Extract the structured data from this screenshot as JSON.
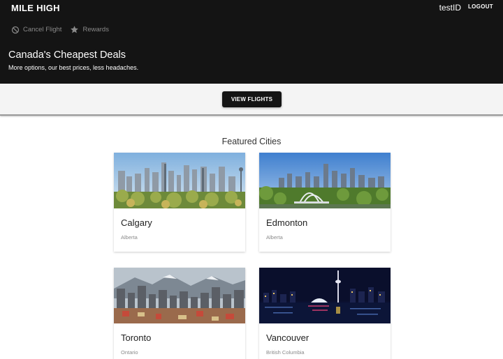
{
  "header": {
    "brand": "MILE HIGH",
    "user": "testID",
    "logout_label": "LOGOUT",
    "nav": [
      {
        "label": "Cancel Flight",
        "icon": "block-icon"
      },
      {
        "label": "Rewards",
        "icon": "star-icon"
      }
    ],
    "title": "Canada's Cheapest Deals",
    "subtitle": "More options, our best prices, less headaches."
  },
  "cta": {
    "label": "VIEW FLIGHTS"
  },
  "featured": {
    "title": "Featured Cities",
    "cities": [
      {
        "name": "Calgary",
        "province": "Alberta"
      },
      {
        "name": "Edmonton",
        "province": "Alberta"
      },
      {
        "name": "Toronto",
        "province": "Ontario"
      },
      {
        "name": "Vancouver",
        "province": "British Columbia"
      }
    ]
  },
  "colors": {
    "header_bg": "#141414",
    "band_bg": "#f4f4f4",
    "button_bg": "#141414",
    "muted_text": "#8a8a8a"
  }
}
